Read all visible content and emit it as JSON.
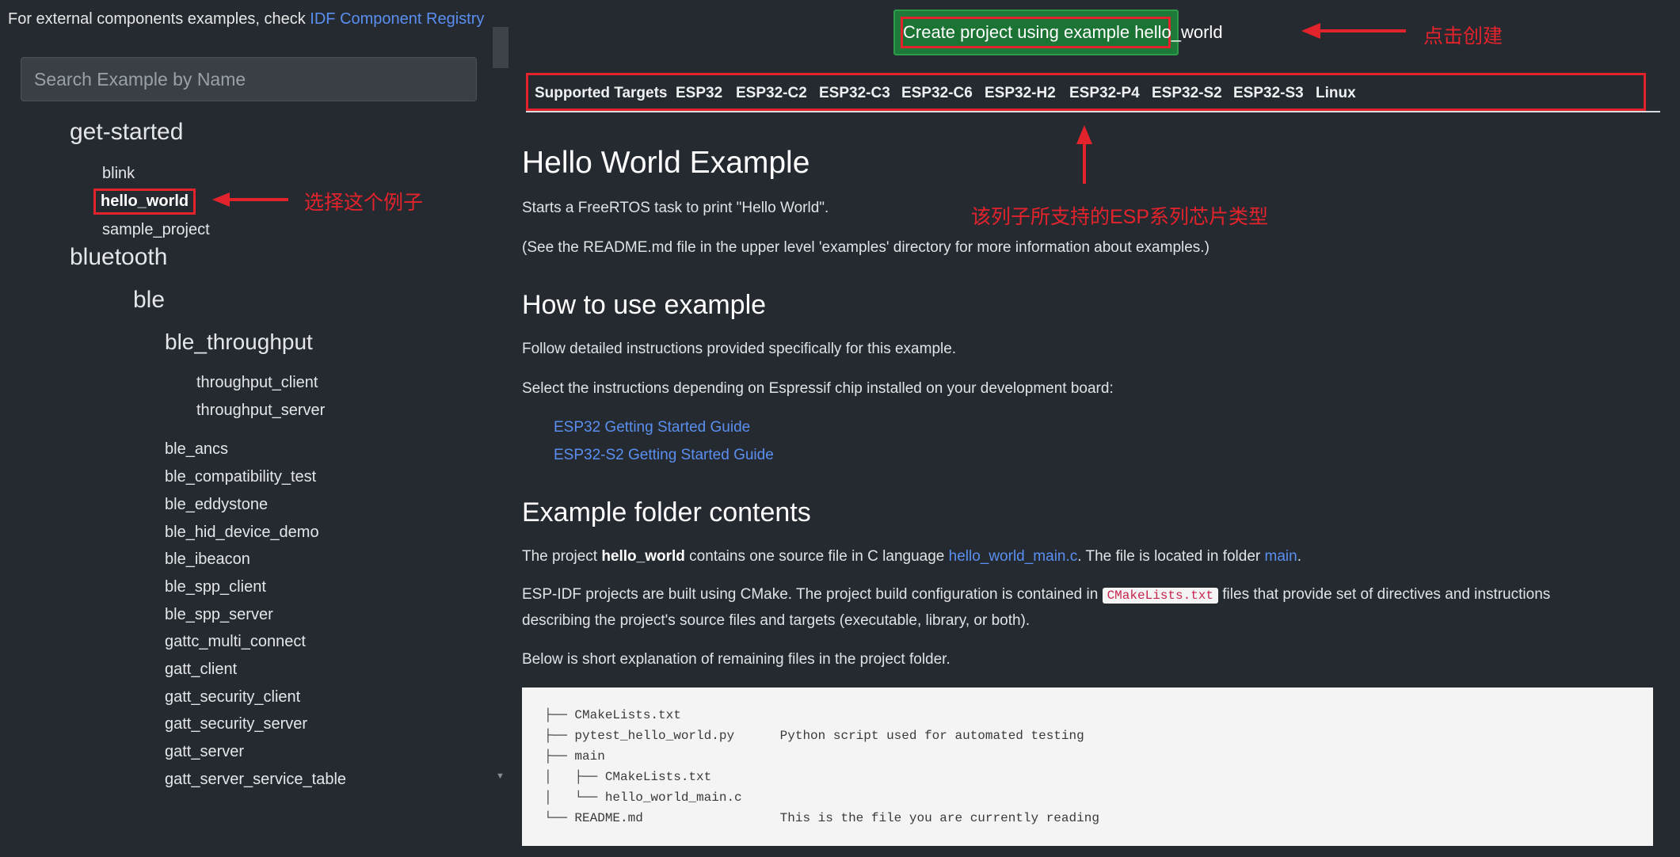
{
  "sidebar": {
    "external_note": "For external components examples, check ",
    "registry_link": "IDF Component Registry",
    "search_placeholder": "Search Example by Name",
    "tree": {
      "get_started": "get-started",
      "blink": "blink",
      "hello_world": "hello_world",
      "sample_project": "sample_project",
      "bluetooth": "bluetooth",
      "ble": "ble",
      "ble_throughput": "ble_throughput",
      "throughput_client": "throughput_client",
      "throughput_server": "throughput_server",
      "ble_items": [
        "ble_ancs",
        "ble_compatibility_test",
        "ble_eddystone",
        "ble_hid_device_demo",
        "ble_ibeacon",
        "ble_spp_client",
        "ble_spp_server",
        "gattc_multi_connect",
        "gatt_client",
        "gatt_security_client",
        "gatt_security_server",
        "gatt_server",
        "gatt_server_service_table"
      ]
    }
  },
  "main": {
    "create_button": "Create project using example hello_world",
    "targets": {
      "header": "Supported Targets",
      "items": [
        "ESP32",
        "ESP32-C2",
        "ESP32-C3",
        "ESP32-C6",
        "ESP32-H2",
        "ESP32-P4",
        "ESP32-S2",
        "ESP32-S3",
        "Linux"
      ]
    },
    "title": "Hello World Example",
    "intro": "Starts a FreeRTOS task to print \"Hello World\".",
    "see_readme": "(See the README.md file in the upper level 'examples' directory for more information about examples.)",
    "how_to_heading": "How to use example",
    "how_to_p1": "Follow detailed instructions provided specifically for this example.",
    "how_to_p2": "Select the instructions depending on Espressif chip installed on your development board:",
    "guide_links": [
      "ESP32 Getting Started Guide",
      "ESP32-S2 Getting Started Guide"
    ],
    "folder_heading": "Example folder contents",
    "folder_p1": {
      "prefix": "The project ",
      "bold": "hello_world",
      "middle": " contains one source file in C language ",
      "link_file": "hello_world_main.c",
      "middle2": ". The file is located in folder ",
      "link_folder": "main",
      "suffix": "."
    },
    "folder_p2": {
      "prefix": "ESP-IDF projects are built using CMake. The project build configuration is contained in ",
      "code": "CMakeLists.txt",
      "suffix": " files that provide set of directives and instructions",
      "line2": "describing the project's source files and targets (executable, library, or both)."
    },
    "folder_p3": "Below is short explanation of remaining files in the project folder.",
    "code_lines": [
      "├── CMakeLists.txt",
      "├── pytest_hello_world.py      Python script used for automated testing",
      "├── main",
      "│   ├── CMakeLists.txt",
      "│   └── hello_world_main.c",
      "└── README.md                  This is the file you are currently reading"
    ]
  },
  "annotations": {
    "click_create": "点击创建",
    "select_example": "选择这个例子",
    "supported_chips": "该列子所支持的ESP系列芯片类型"
  },
  "colors": {
    "background": "#252a31",
    "highlight_red": "#e3232c",
    "create_green": "#1e7a38",
    "link_blue": "#5a8ff0"
  }
}
